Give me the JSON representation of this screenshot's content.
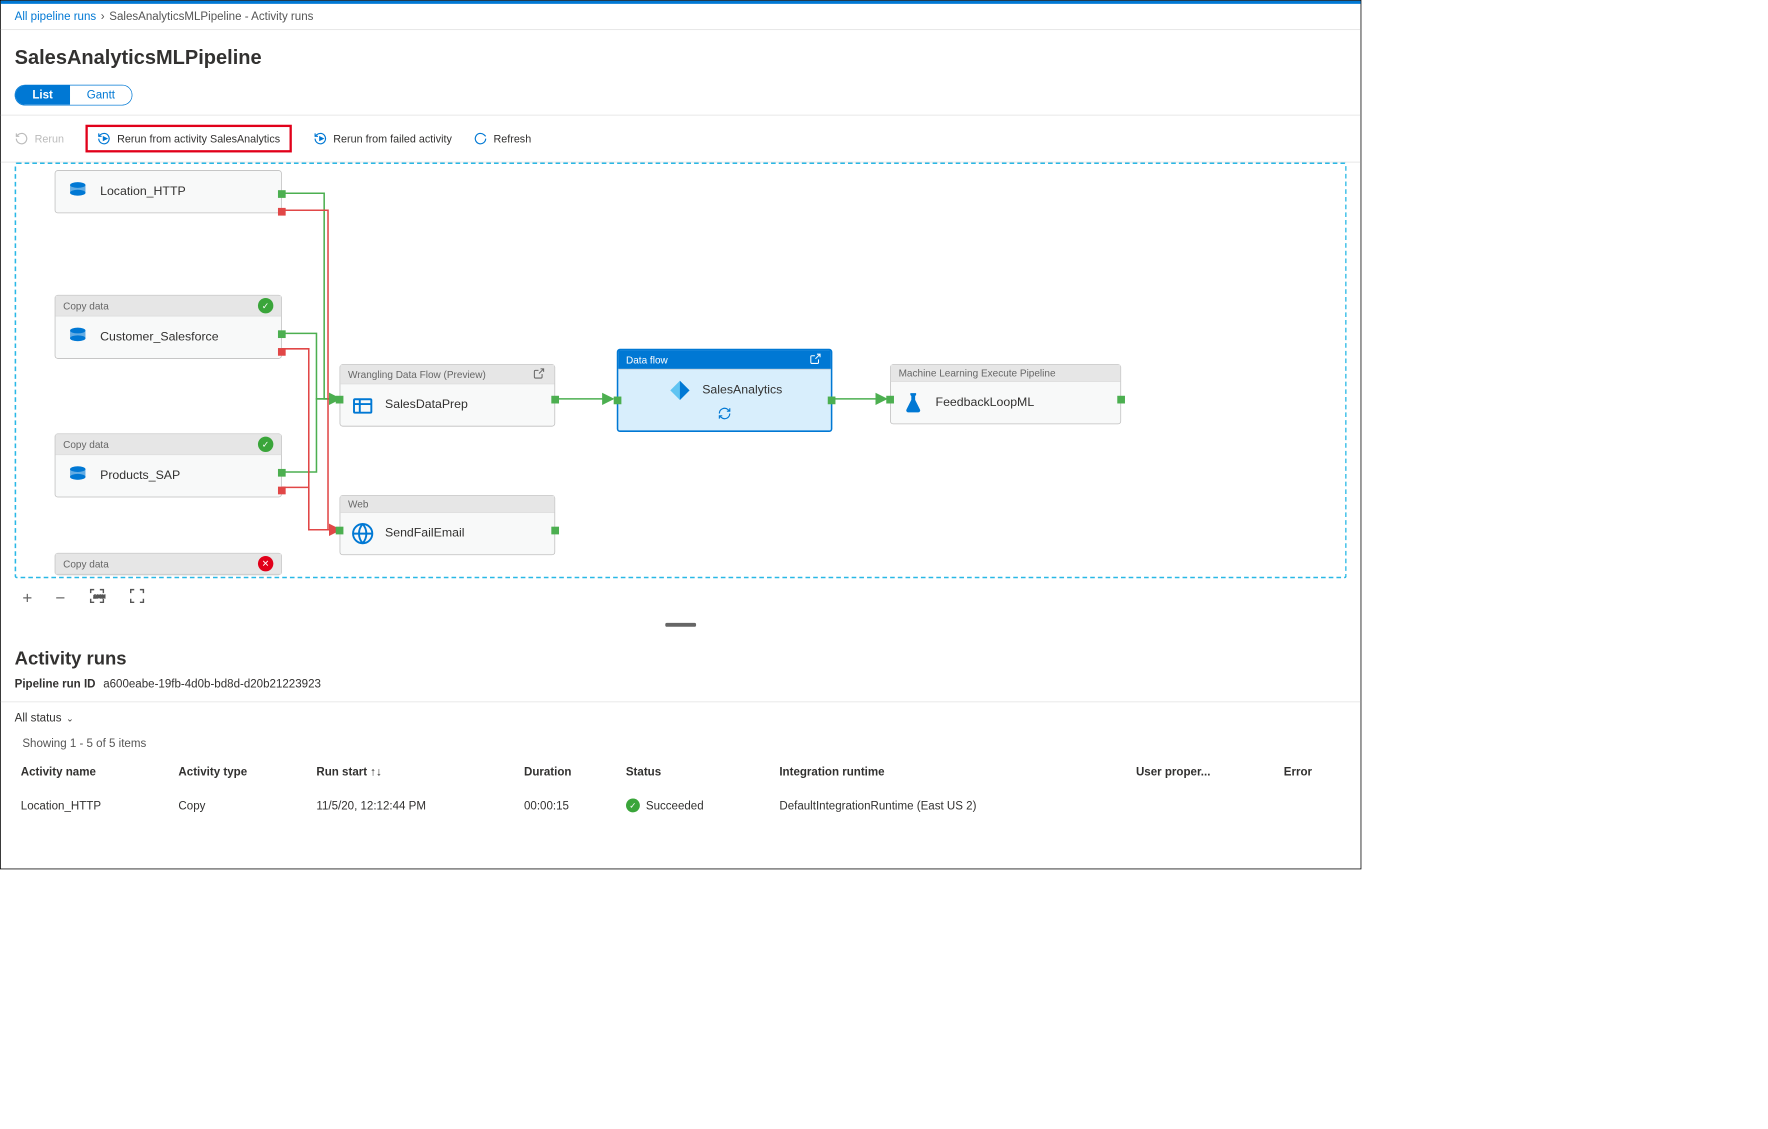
{
  "breadcrumb": {
    "parent": "All pipeline runs",
    "current": "SalesAnalyticsMLPipeline - Activity runs"
  },
  "page_title": "SalesAnalyticsMLPipeline",
  "view_tabs": {
    "list": "List",
    "gantt": "Gantt"
  },
  "toolbar": {
    "rerun": "Rerun",
    "rerun_from_activity": "Rerun from activity SalesAnalytics",
    "rerun_from_failed": "Rerun from failed activity",
    "refresh": "Refresh"
  },
  "nodes": {
    "location": {
      "name": "Location_HTTP"
    },
    "customer": {
      "header": "Copy data",
      "name": "Customer_Salesforce"
    },
    "products": {
      "header": "Copy data",
      "name": "Products_SAP"
    },
    "copy4": {
      "header": "Copy data"
    },
    "wrangling": {
      "header": "Wrangling Data Flow (Preview)",
      "name": "SalesDataPrep"
    },
    "web": {
      "header": "Web",
      "name": "SendFailEmail"
    },
    "dataflow": {
      "header": "Data flow",
      "name": "SalesAnalytics"
    },
    "ml": {
      "header": "Machine Learning Execute Pipeline",
      "name": "FeedbackLoopML"
    }
  },
  "activity_runs": {
    "heading": "Activity runs",
    "run_id_label": "Pipeline run ID",
    "run_id": "a600eabe-19fb-4d0b-bd8d-d20b21223923",
    "filter": "All status",
    "showing": "Showing 1 - 5 of 5 items",
    "columns": {
      "name": "Activity name",
      "type": "Activity type",
      "start": "Run start",
      "duration": "Duration",
      "status": "Status",
      "runtime": "Integration runtime",
      "user": "User proper...",
      "error": "Error"
    },
    "rows": [
      {
        "name": "Location_HTTP",
        "type": "Copy",
        "start": "11/5/20, 12:12:44 PM",
        "duration": "00:00:15",
        "status": "Succeeded",
        "runtime": "DefaultIntegrationRuntime (East US 2)"
      }
    ]
  }
}
